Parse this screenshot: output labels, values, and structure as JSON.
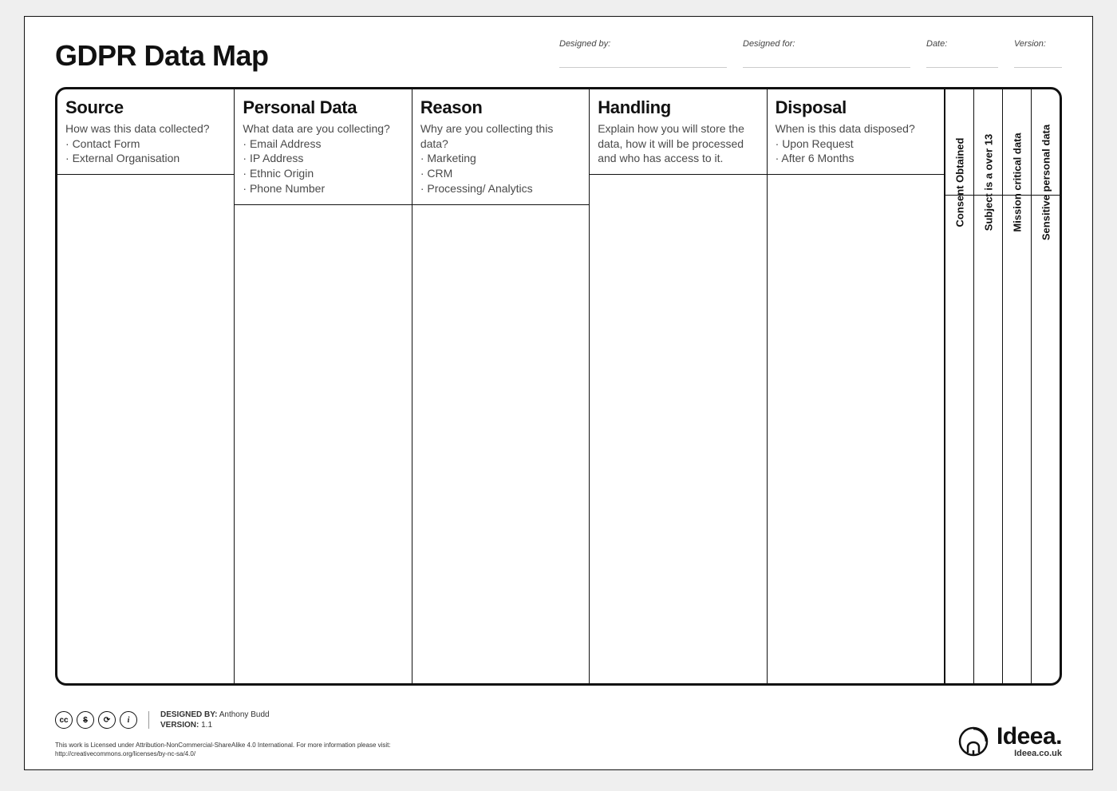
{
  "header": {
    "title": "GDPR Data Map",
    "meta": {
      "designed_by_label": "Designed by:",
      "designed_by_value": "",
      "designed_for_label": "Designed for:",
      "designed_for_value": "",
      "date_label": "Date:",
      "date_value": "",
      "version_label": "Version:",
      "version_value": ""
    }
  },
  "columns": [
    {
      "title": "Source",
      "subtitle": "How was this data collected?",
      "examples": [
        "Contact Form",
        "External Organisation"
      ]
    },
    {
      "title": "Personal Data",
      "subtitle": "What data are you collecting?",
      "examples": [
        "Email Address",
        "IP Address",
        "Ethnic Origin",
        "Phone Number"
      ]
    },
    {
      "title": "Reason",
      "subtitle": "Why are you collecting this data?",
      "examples": [
        "Marketing",
        "CRM",
        "Processing/ Analytics"
      ]
    },
    {
      "title": "Handling",
      "subtitle": "Explain how you will store the data, how it will be processed and who has access to it.",
      "examples": []
    },
    {
      "title": "Disposal",
      "subtitle": "When is this data disposed?",
      "examples": [
        "Upon Request",
        "After 6 Months"
      ]
    }
  ],
  "check_columns": [
    "Consent Obtained",
    "Subject is a over 13",
    "Mission critical data",
    "Sensitive personal data"
  ],
  "footer": {
    "cc_icons": [
      "cc",
      "$",
      "⟳",
      "i"
    ],
    "designed_by_label": "DESIGNED BY:",
    "designed_by_value": "Anthony Budd",
    "version_label": "VERSION:",
    "version_value": "1.1",
    "license_line1": "This work is Licensed under Attribution-NonCommercial-ShareAlike 4.0 International. For more information please visit:",
    "license_line2": "http://creativecommons.org/licenses/by-nc-sa/4.0/",
    "brand_name": "Ideea.",
    "brand_url": "Ideea.co.uk"
  }
}
